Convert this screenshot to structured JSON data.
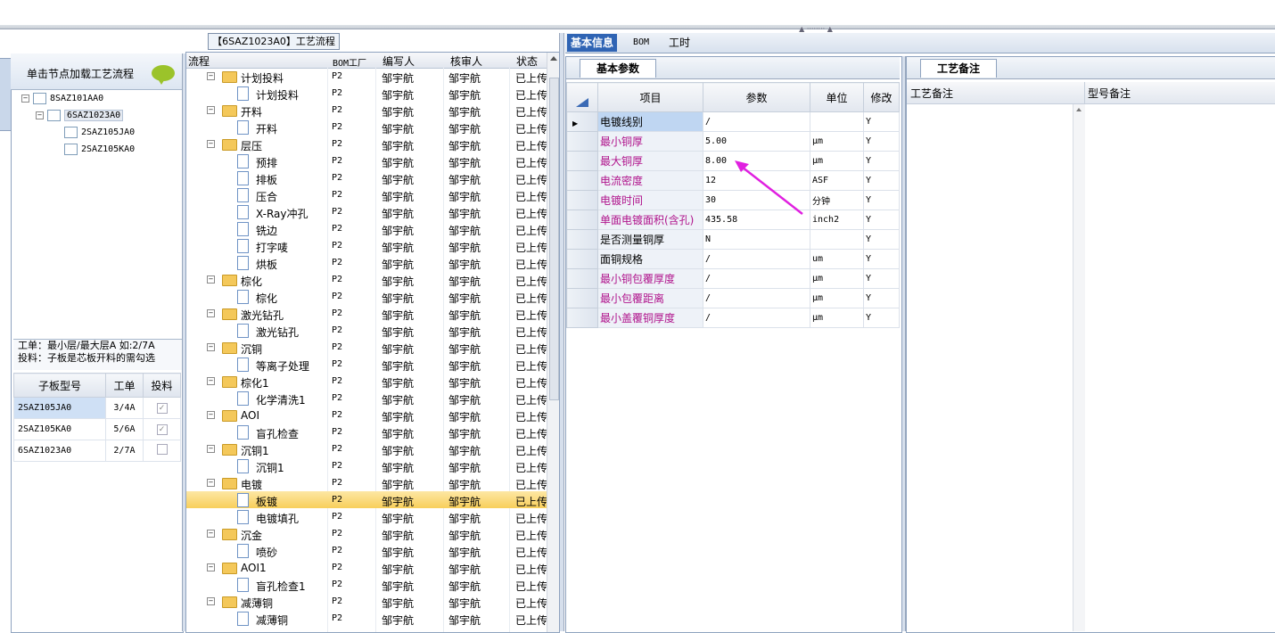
{
  "left": {
    "header_text": "单击节点加载工艺流程",
    "tree": [
      {
        "label": "8SAZ101AA0"
      },
      {
        "label": "6SAZ1023A0"
      },
      {
        "label": "2SAZ105JA0"
      },
      {
        "label": "2SAZ105KA0"
      }
    ],
    "note_line1": "工单：最小层/最大层A 如:2/7A",
    "note_line2": "投料：子板是芯板开料的需勾选",
    "grid_headers": [
      "子板型号",
      "工单",
      "投料"
    ],
    "grid_rows": [
      {
        "model": "2SAZ105JA0",
        "order": "3/4A",
        "feed": "✓"
      },
      {
        "model": "2SAZ105KA0",
        "order": "5/6A",
        "feed": "✓"
      },
      {
        "model": "6SAZ1023A0",
        "order": "2/7A",
        "feed": ""
      }
    ]
  },
  "process": {
    "title": "【6SAZ1023A0】工艺流程",
    "headers": [
      "流程",
      "BOM工厂",
      "编写人",
      "核审人",
      "状态"
    ],
    "rows": [
      {
        "name": "计划投料",
        "plant": "P2",
        "author": "邹宇航",
        "reviewer": "邹宇航",
        "status": "已上传"
      },
      {
        "name": "计划投料",
        "plant": "P2",
        "author": "邹宇航",
        "reviewer": "邹宇航",
        "status": "已上传"
      },
      {
        "name": "开料",
        "plant": "P2",
        "author": "邹宇航",
        "reviewer": "邹宇航",
        "status": "已上传"
      },
      {
        "name": "开料",
        "plant": "P2",
        "author": "邹宇航",
        "reviewer": "邹宇航",
        "status": "已上传"
      },
      {
        "name": "层压",
        "plant": "P2",
        "author": "邹宇航",
        "reviewer": "邹宇航",
        "status": "已上传"
      },
      {
        "name": "预排",
        "plant": "P2",
        "author": "邹宇航",
        "reviewer": "邹宇航",
        "status": "已上传"
      },
      {
        "name": "排板",
        "plant": "P2",
        "author": "邹宇航",
        "reviewer": "邹宇航",
        "status": "已上传"
      },
      {
        "name": "压合",
        "plant": "P2",
        "author": "邹宇航",
        "reviewer": "邹宇航",
        "status": "已上传"
      },
      {
        "name": "X-Ray冲孔",
        "plant": "P2",
        "author": "邹宇航",
        "reviewer": "邹宇航",
        "status": "已上传"
      },
      {
        "name": "铣边",
        "plant": "P2",
        "author": "邹宇航",
        "reviewer": "邹宇航",
        "status": "已上传"
      },
      {
        "name": "打字唛",
        "plant": "P2",
        "author": "邹宇航",
        "reviewer": "邹宇航",
        "status": "已上传"
      },
      {
        "name": "烘板",
        "plant": "P2",
        "author": "邹宇航",
        "reviewer": "邹宇航",
        "status": "已上传"
      },
      {
        "name": "棕化",
        "plant": "P2",
        "author": "邹宇航",
        "reviewer": "邹宇航",
        "status": "已上传"
      },
      {
        "name": "棕化",
        "plant": "P2",
        "author": "邹宇航",
        "reviewer": "邹宇航",
        "status": "已上传"
      },
      {
        "name": "激光钻孔",
        "plant": "P2",
        "author": "邹宇航",
        "reviewer": "邹宇航",
        "status": "已上传"
      },
      {
        "name": "激光钻孔",
        "plant": "P2",
        "author": "邹宇航",
        "reviewer": "邹宇航",
        "status": "已上传"
      },
      {
        "name": "沉铜",
        "plant": "P2",
        "author": "邹宇航",
        "reviewer": "邹宇航",
        "status": "已上传"
      },
      {
        "name": "等离子处理",
        "plant": "P2",
        "author": "邹宇航",
        "reviewer": "邹宇航",
        "status": "已上传"
      },
      {
        "name": "棕化1",
        "plant": "P2",
        "author": "邹宇航",
        "reviewer": "邹宇航",
        "status": "已上传"
      },
      {
        "name": "化学清洗1",
        "plant": "P2",
        "author": "邹宇航",
        "reviewer": "邹宇航",
        "status": "已上传"
      },
      {
        "name": "AOI",
        "plant": "P2",
        "author": "邹宇航",
        "reviewer": "邹宇航",
        "status": "已上传"
      },
      {
        "name": "盲孔检查",
        "plant": "P2",
        "author": "邹宇航",
        "reviewer": "邹宇航",
        "status": "已上传"
      },
      {
        "name": "沉铜1",
        "plant": "P2",
        "author": "邹宇航",
        "reviewer": "邹宇航",
        "status": "已上传"
      },
      {
        "name": "沉铜1",
        "plant": "P2",
        "author": "邹宇航",
        "reviewer": "邹宇航",
        "status": "已上传"
      },
      {
        "name": "电镀",
        "plant": "P2",
        "author": "邹宇航",
        "reviewer": "邹宇航",
        "status": "已上传"
      },
      {
        "name": "板镀",
        "plant": "P2",
        "author": "邹宇航",
        "reviewer": "邹宇航",
        "status": "已上传"
      },
      {
        "name": "电镀填孔",
        "plant": "P2",
        "author": "邹宇航",
        "reviewer": "邹宇航",
        "status": "已上传"
      },
      {
        "name": "沉金",
        "plant": "P2",
        "author": "邹宇航",
        "reviewer": "邹宇航",
        "status": "已上传"
      },
      {
        "name": "喷砂",
        "plant": "P2",
        "author": "邹宇航",
        "reviewer": "邹宇航",
        "status": "已上传"
      },
      {
        "name": "AOI1",
        "plant": "P2",
        "author": "邹宇航",
        "reviewer": "邹宇航",
        "status": "已上传"
      },
      {
        "name": "盲孔检查1",
        "plant": "P2",
        "author": "邹宇航",
        "reviewer": "邹宇航",
        "status": "已上传"
      },
      {
        "name": "减薄铜",
        "plant": "P2",
        "author": "邹宇航",
        "reviewer": "邹宇航",
        "status": "已上传"
      },
      {
        "name": "减薄铜",
        "plant": "P2",
        "author": "邹宇航",
        "reviewer": "邹宇航",
        "status": "已上传"
      }
    ]
  },
  "right": {
    "tabs": [
      "基本信息",
      "BOM",
      "工时"
    ],
    "param_tab": "基本参数",
    "param_headers": [
      "项目",
      "参数",
      "单位",
      "修改"
    ],
    "params": [
      {
        "item": "电镀线别",
        "value": "/",
        "unit": "",
        "mod": "Y"
      },
      {
        "item": "最小铜厚",
        "value": "5.00",
        "unit": "μm",
        "mod": "Y"
      },
      {
        "item": "最大铜厚",
        "value": "8.00",
        "unit": "μm",
        "mod": "Y"
      },
      {
        "item": "电流密度",
        "value": "12",
        "unit": "ASF",
        "mod": "Y"
      },
      {
        "item": "电镀时间",
        "value": "30",
        "unit": "分钟",
        "mod": "Y"
      },
      {
        "item": "单面电镀面积(含孔)",
        "value": "435.58",
        "unit": "inch2",
        "mod": "Y"
      },
      {
        "item": "是否测量铜厚",
        "value": "N",
        "unit": "",
        "mod": "Y"
      },
      {
        "item": "面铜规格",
        "value": "/",
        "unit": "um",
        "mod": "Y"
      },
      {
        "item": "最小铜包覆厚度",
        "value": "/",
        "unit": "μm",
        "mod": "Y"
      },
      {
        "item": "最小包覆距离",
        "value": "/",
        "unit": "μm",
        "mod": "Y"
      },
      {
        "item": "最小盖覆铜厚度",
        "value": "/",
        "unit": "μm",
        "mod": "Y"
      }
    ],
    "remark_tab": "工艺备注",
    "remark_col1": "工艺备注",
    "remark_col2": "型号备注"
  },
  "colors": {
    "accent": "#2f64b4",
    "selected_row": "#f8cf5b",
    "magenta_label": "#b0148c",
    "arrow": "#e020e0"
  }
}
